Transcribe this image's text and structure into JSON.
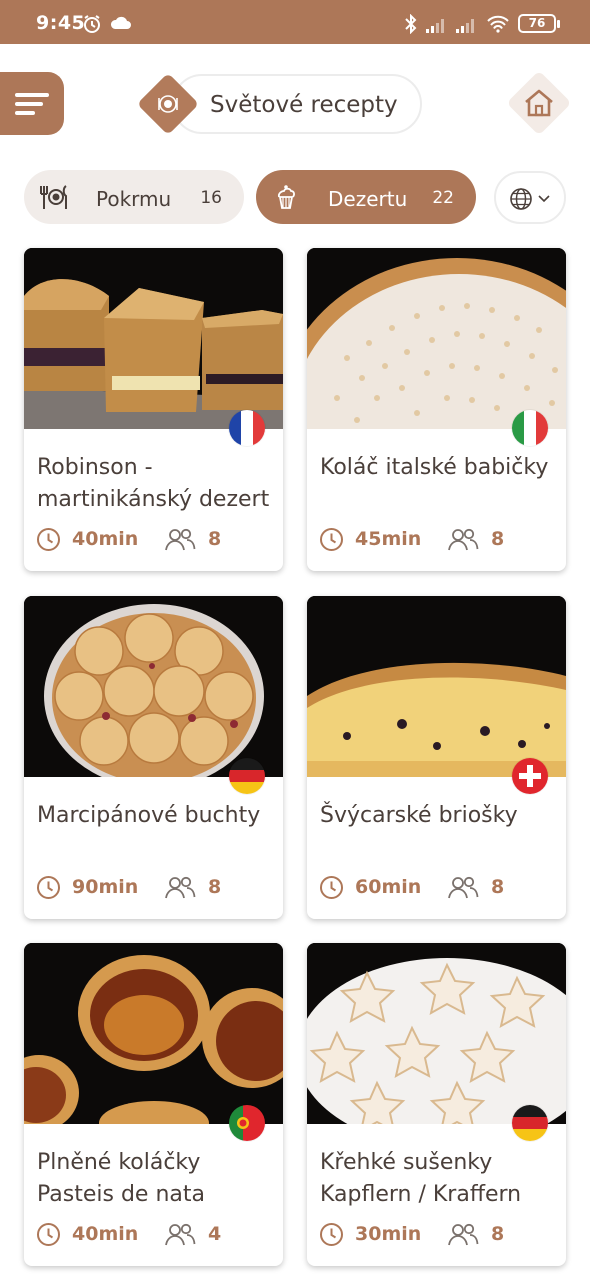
{
  "status_bar": {
    "time": "9:45",
    "battery": "76"
  },
  "header": {
    "title": "Světové recepty"
  },
  "filters": {
    "food": {
      "label": "Pokrmu",
      "count": "16"
    },
    "dessert": {
      "label": "Dezertu",
      "count": "22"
    }
  },
  "colors": {
    "accent": "#ad7758",
    "text": "#4a3f3a"
  },
  "recipes": [
    {
      "name": "Robinson - martinikánský dezert",
      "time": "40min",
      "servings": "8",
      "flag": "france"
    },
    {
      "name": "Koláč italské babičky",
      "time": "45min",
      "servings": "8",
      "flag": "italy"
    },
    {
      "name": "Marcipánové buchty",
      "time": "90min",
      "servings": "8",
      "flag": "germany"
    },
    {
      "name": "Švýcarské briošky",
      "time": "60min",
      "servings": "8",
      "flag": "switzerland"
    },
    {
      "name": "Plněné koláčky Pasteis de nata",
      "time": "40min",
      "servings": "4",
      "flag": "portugal"
    },
    {
      "name": "Křehké sušenky Kapflern / Kraffern",
      "time": "30min",
      "servings": "8",
      "flag": "germany"
    }
  ]
}
